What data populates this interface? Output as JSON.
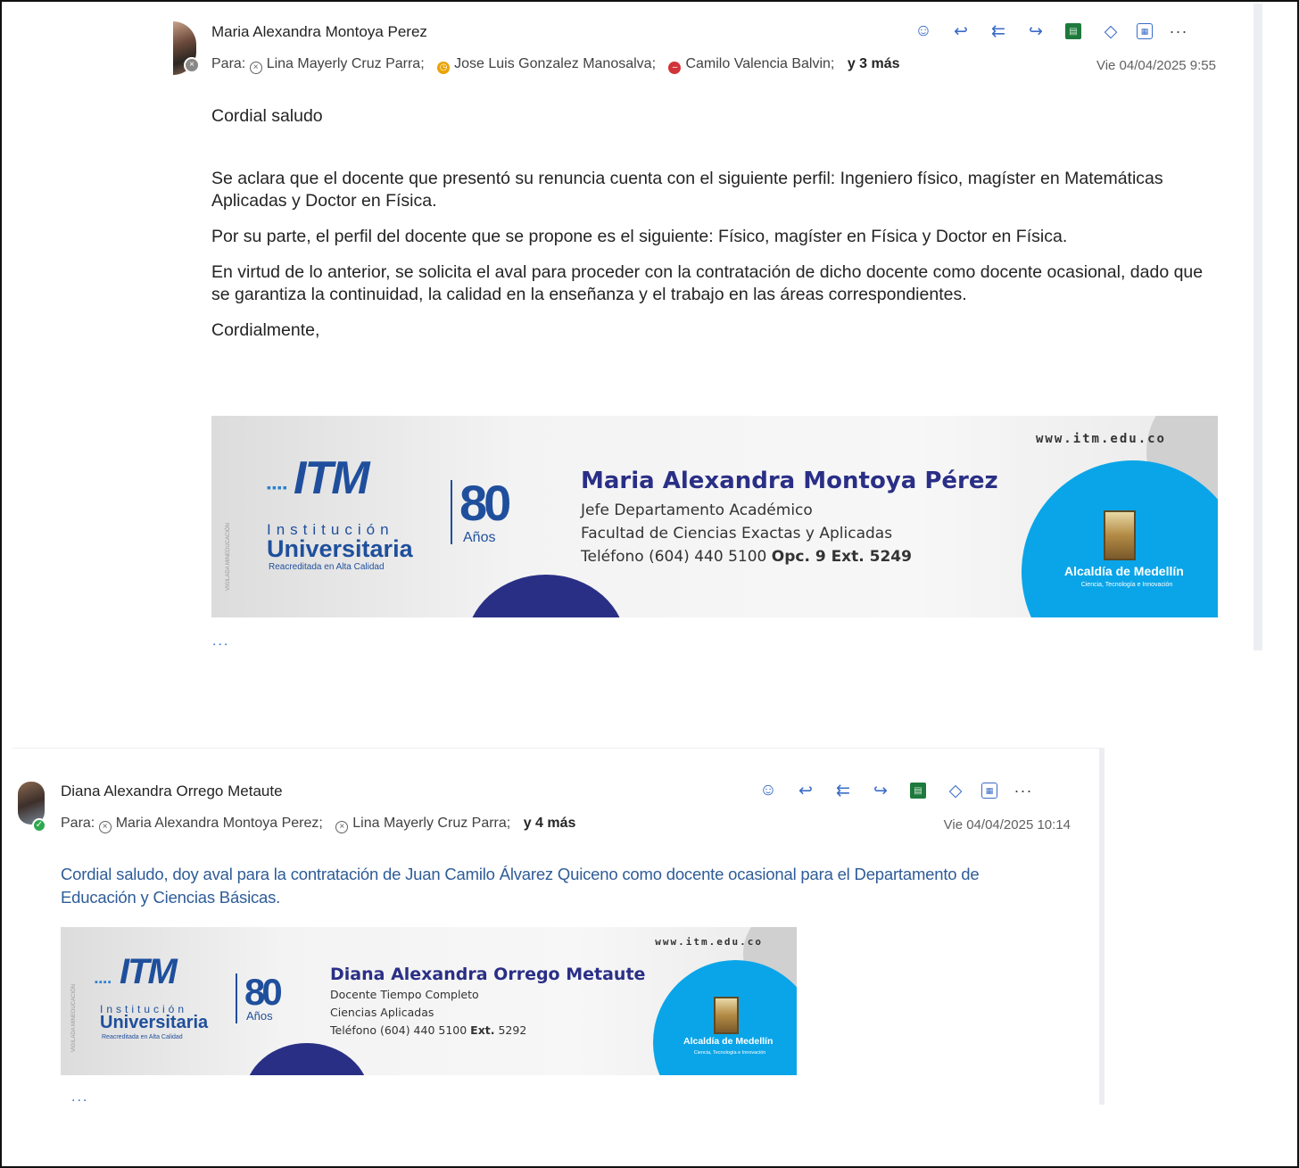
{
  "email1": {
    "sender": "Maria Alexandra Montoya Perez",
    "to_label": "Para:",
    "recipients": [
      {
        "name": "Lina Mayerly Cruz Parra;",
        "status": "blocked"
      },
      {
        "name": "Jose Luis Gonzalez Manosalva;",
        "status": "away"
      },
      {
        "name": "Camilo Valencia Balvin;",
        "status": "busy"
      }
    ],
    "more": "y 3 más",
    "date": "Vie 04/04/2025 9:55",
    "body": {
      "greeting": "Cordial saludo",
      "p1": "Se aclara que el docente que presentó su renuncia cuenta con el siguiente perfil: Ingeniero físico, magíster en Matemáticas Aplicadas y Doctor en Física.",
      "p2": "Por su parte, el perfil del docente que se propone es el siguiente: Físico, magíster en Física y Doctor en Física.",
      "p3": "En virtud de lo anterior, se solicita el aval para proceder con la contratación de dicho docente como docente ocasional, dado que se garantiza la continuidad, la calidad en la enseñanza y el trabajo en las áreas correspondientes.",
      "closing": "Cordialmente,"
    },
    "signature": {
      "url": "www.itm.edu.co",
      "logo": "ITM",
      "institucion": "Institución",
      "universitaria": "Universitaria",
      "reacreditada": "Reacreditada en Alta Calidad",
      "years": "80",
      "anos": "Años",
      "name": "Maria Alexandra Montoya Pérez",
      "title": "Jefe Departamento Académico",
      "faculty": "Facultad de Ciencias Exactas y Aplicadas",
      "phone": "Teléfono (604) 440 5100",
      "phone_ext": "Opc. 9 Ext. 5249",
      "alcaldia": "Alcaldía de Medellín",
      "alcaldia_sub": "Ciencia, Tecnología e Innovación"
    },
    "show_more": "..."
  },
  "email2": {
    "sender": "Diana Alexandra Orrego Metaute",
    "to_label": "Para:",
    "recipients": [
      {
        "name": "Maria Alexandra Montoya Perez;",
        "status": "blocked"
      },
      {
        "name": "Lina Mayerly Cruz Parra;",
        "status": "blocked"
      }
    ],
    "more": "y 4 más",
    "date": "Vie 04/04/2025 10:14",
    "body": "Cordial saludo, doy aval para la contratación de Juan Camilo Álvarez Quiceno como docente ocasional para el Departamento de Educación y Ciencias Básicas.",
    "signature": {
      "url": "www.itm.edu.co",
      "logo": "ITM",
      "institucion": "Institución",
      "universitaria": "Universitaria",
      "reacreditada": "Reacreditada en Alta Calidad",
      "years": "80",
      "anos": "Años",
      "name": "Diana Alexandra Orrego Metaute",
      "title": "Docente Tiempo Completo",
      "faculty": "Ciencias Aplicadas",
      "phone": "Teléfono (604) 440 5100",
      "phone_ext": "Ext.",
      "phone_num": "5292",
      "alcaldia": "Alcaldía de Medellín",
      "alcaldia_sub": "Ciencia, Tecnología e Innovación"
    },
    "show_more": "..."
  },
  "toolbar_icons": [
    "smiley-icon",
    "reply-icon",
    "reply-all-icon",
    "forward-icon",
    "excel-icon",
    "loop-icon",
    "apps-icon",
    "more-icon"
  ],
  "colors": {
    "accent": "#3a6cc7",
    "reply_text": "#2e5c98",
    "itm_navy": "#2a2f86",
    "medellin_blue": "#0aa5e8"
  }
}
